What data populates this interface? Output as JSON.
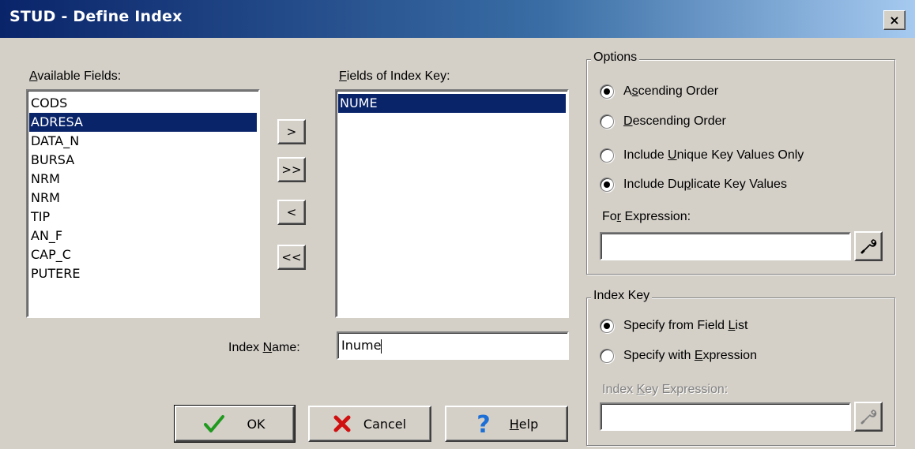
{
  "window": {
    "title": "STUD - Define Index",
    "close_glyph": "×"
  },
  "available_fields": {
    "label_prefix": "",
    "label_ul": "A",
    "label_rest": "vailable Fields:",
    "items": [
      "CODS",
      "ADRESA",
      "DATA_N",
      "BURSA",
      "NRM",
      "NRM",
      "TIP",
      "AN_F",
      "CAP_C",
      "PUTERE"
    ],
    "selected_index": 1
  },
  "move_buttons": {
    "add": ">",
    "add_all": ">>",
    "remove": "<",
    "remove_all": "<<"
  },
  "index_key_fields": {
    "label_prefix": "",
    "label_ul": "F",
    "label_rest": "ields of Index Key:",
    "items": [
      "NUME"
    ],
    "selected_index": 0
  },
  "index_name": {
    "label_prefix": "Index ",
    "label_ul": "N",
    "label_rest": "ame:",
    "value": "Inume"
  },
  "buttons": {
    "ok": "OK",
    "cancel": "Cancel",
    "help_prefix": "",
    "help_ul": "H",
    "help_rest": "elp"
  },
  "options": {
    "title": "Options",
    "ascending": {
      "prefix": "A",
      "ul": "s",
      "rest": "cending Order",
      "checked": true
    },
    "descending": {
      "prefix": "",
      "ul": "D",
      "rest": "escending Order",
      "checked": false
    },
    "unique": {
      "prefix": "Include ",
      "ul": "U",
      "rest": "nique Key Values Only",
      "checked": false
    },
    "duplicate": {
      "prefix": "Include Du",
      "ul": "p",
      "rest": "licate Key Values",
      "checked": true
    },
    "for_expression": {
      "prefix": "Fo",
      "ul": "r",
      "rest": " Expression:",
      "value": ""
    }
  },
  "index_key": {
    "title": "Index Key",
    "from_list": {
      "prefix": "Specify from Field ",
      "ul": "L",
      "rest": "ist",
      "checked": true
    },
    "with_expr": {
      "prefix": "Specify with ",
      "ul": "E",
      "rest": "xpression",
      "checked": false
    },
    "expression": {
      "prefix": "Index ",
      "ul": "K",
      "rest": "ey Expression:",
      "value": ""
    }
  },
  "icons": {
    "ok": "checkmark-icon",
    "cancel": "x-icon",
    "help": "question-mark-icon",
    "builder": "wrench-icon"
  },
  "colors": {
    "selection": "#0a246a",
    "face": "#d4d0c8",
    "ok_green": "#1f9a1f",
    "cancel_red": "#d01010",
    "help_blue": "#1c6fd6"
  }
}
